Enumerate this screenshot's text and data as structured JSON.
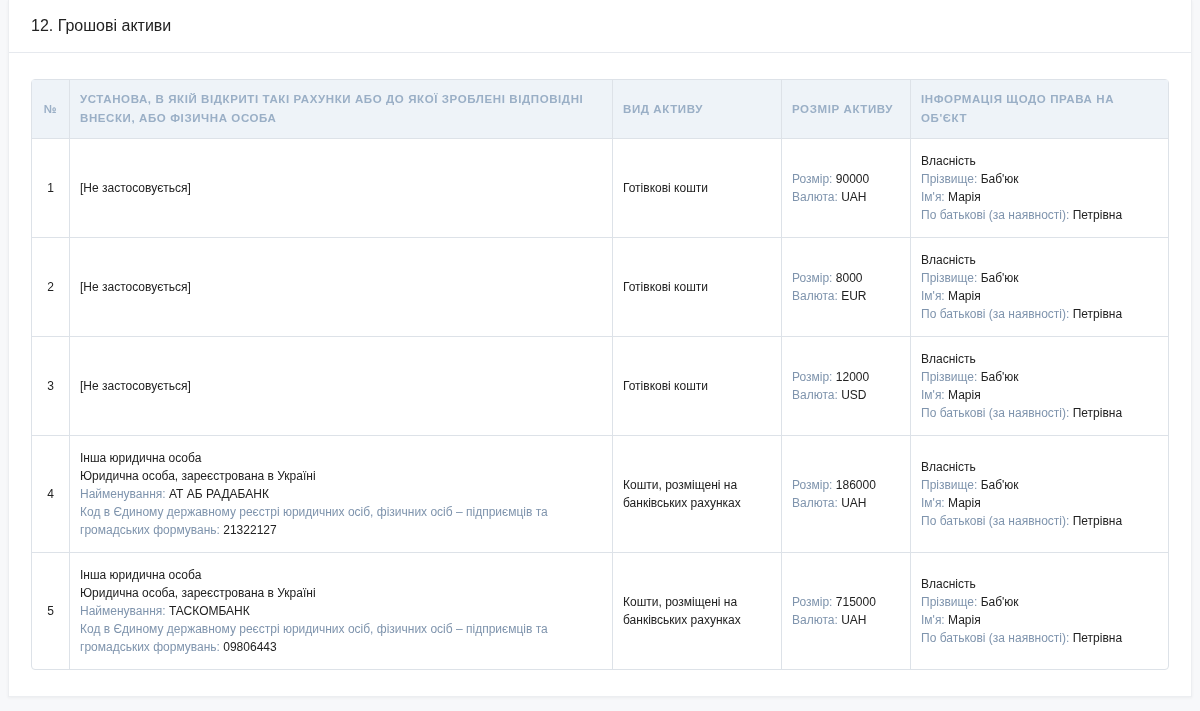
{
  "section": {
    "title": "12. Грошові активи"
  },
  "table": {
    "columns": [
      "№",
      "УСТАНОВА, В ЯКІЙ ВІДКРИТІ ТАКІ РАХУНКИ АБО ДО ЯКОЇ ЗРОБЛЕНІ ВІДПОВІДНІ ВНЕСКИ, АБО ФІЗИЧНА ОСОБА",
      "ВИД АКТИВУ",
      "РОЗМІР АКТИВУ",
      "ІНФОРМАЦІЯ ЩОДО ПРАВА НА ОБ'ЄКТ"
    ],
    "rows": [
      {
        "number": "1",
        "institution": [
          {
            "kind": "plain",
            "text": "[Не застосовується]"
          }
        ],
        "asset_type": "Готівкові кошти",
        "size": [
          {
            "kind": "field",
            "label": "Розмір:",
            "value": "90000"
          },
          {
            "kind": "field",
            "label": "Валюта:",
            "value": "UAH"
          }
        ],
        "rights": [
          {
            "kind": "plain",
            "text": "Власність"
          },
          {
            "kind": "field",
            "label": "Прізвище:",
            "value": "Баб'юк"
          },
          {
            "kind": "field",
            "label": "Ім'я:",
            "value": "Марія"
          },
          {
            "kind": "field",
            "label": "По батькові (за наявності):",
            "value": "Петрівна"
          }
        ]
      },
      {
        "number": "2",
        "institution": [
          {
            "kind": "plain",
            "text": "[Не застосовується]"
          }
        ],
        "asset_type": "Готівкові кошти",
        "size": [
          {
            "kind": "field",
            "label": "Розмір:",
            "value": "8000"
          },
          {
            "kind": "field",
            "label": "Валюта:",
            "value": "EUR"
          }
        ],
        "rights": [
          {
            "kind": "plain",
            "text": "Власність"
          },
          {
            "kind": "field",
            "label": "Прізвище:",
            "value": "Баб'юк"
          },
          {
            "kind": "field",
            "label": "Ім'я:",
            "value": "Марія"
          },
          {
            "kind": "field",
            "label": "По батькові (за наявності):",
            "value": "Петрівна"
          }
        ]
      },
      {
        "number": "3",
        "institution": [
          {
            "kind": "plain",
            "text": "[Не застосовується]"
          }
        ],
        "asset_type": "Готівкові кошти",
        "size": [
          {
            "kind": "field",
            "label": "Розмір:",
            "value": "12000"
          },
          {
            "kind": "field",
            "label": "Валюта:",
            "value": "USD"
          }
        ],
        "rights": [
          {
            "kind": "plain",
            "text": "Власність"
          },
          {
            "kind": "field",
            "label": "Прізвище:",
            "value": "Баб'юк"
          },
          {
            "kind": "field",
            "label": "Ім'я:",
            "value": "Марія"
          },
          {
            "kind": "field",
            "label": "По батькові (за наявності):",
            "value": "Петрівна"
          }
        ]
      },
      {
        "number": "4",
        "institution": [
          {
            "kind": "plain",
            "text": "Інша юридична особа"
          },
          {
            "kind": "plain",
            "text": "Юридична особа, зареєстрована в Україні"
          },
          {
            "kind": "field",
            "label": "Найменування:",
            "value": "АТ АБ РАДАБАНК"
          },
          {
            "kind": "field",
            "label": "Код в Єдиному державному реєстрі юридичних осіб, фізичних осіб – підприємців та громадських формувань:",
            "value": "21322127"
          }
        ],
        "asset_type": "Кошти, розміщені на банківських рахунках",
        "size": [
          {
            "kind": "field",
            "label": "Розмір:",
            "value": "186000"
          },
          {
            "kind": "field",
            "label": "Валюта:",
            "value": "UAH"
          }
        ],
        "rights": [
          {
            "kind": "plain",
            "text": "Власність"
          },
          {
            "kind": "field",
            "label": "Прізвище:",
            "value": "Баб'юк"
          },
          {
            "kind": "field",
            "label": "Ім'я:",
            "value": "Марія"
          },
          {
            "kind": "field",
            "label": "По батькові (за наявності):",
            "value": "Петрівна"
          }
        ]
      },
      {
        "number": "5",
        "institution": [
          {
            "kind": "plain",
            "text": "Інша юридична особа"
          },
          {
            "kind": "plain",
            "text": "Юридична особа, зареєстрована в Україні"
          },
          {
            "kind": "field",
            "label": "Найменування:",
            "value": "ТАСКОМБАНК"
          },
          {
            "kind": "field",
            "label": "Код в Єдиному державному реєстрі юридичних осіб, фізичних осіб – підприємців та громадських формувань:",
            "value": "09806443"
          }
        ],
        "asset_type": "Кошти, розміщені на банківських рахунках",
        "size": [
          {
            "kind": "field",
            "label": "Розмір:",
            "value": "715000"
          },
          {
            "kind": "field",
            "label": "Валюта:",
            "value": "UAH"
          }
        ],
        "rights": [
          {
            "kind": "plain",
            "text": "Власність"
          },
          {
            "kind": "field",
            "label": "Прізвище:",
            "value": "Баб'юк"
          },
          {
            "kind": "field",
            "label": "Ім'я:",
            "value": "Марія"
          },
          {
            "kind": "field",
            "label": "По батькові (за наявності):",
            "value": "Петрівна"
          }
        ]
      }
    ]
  }
}
